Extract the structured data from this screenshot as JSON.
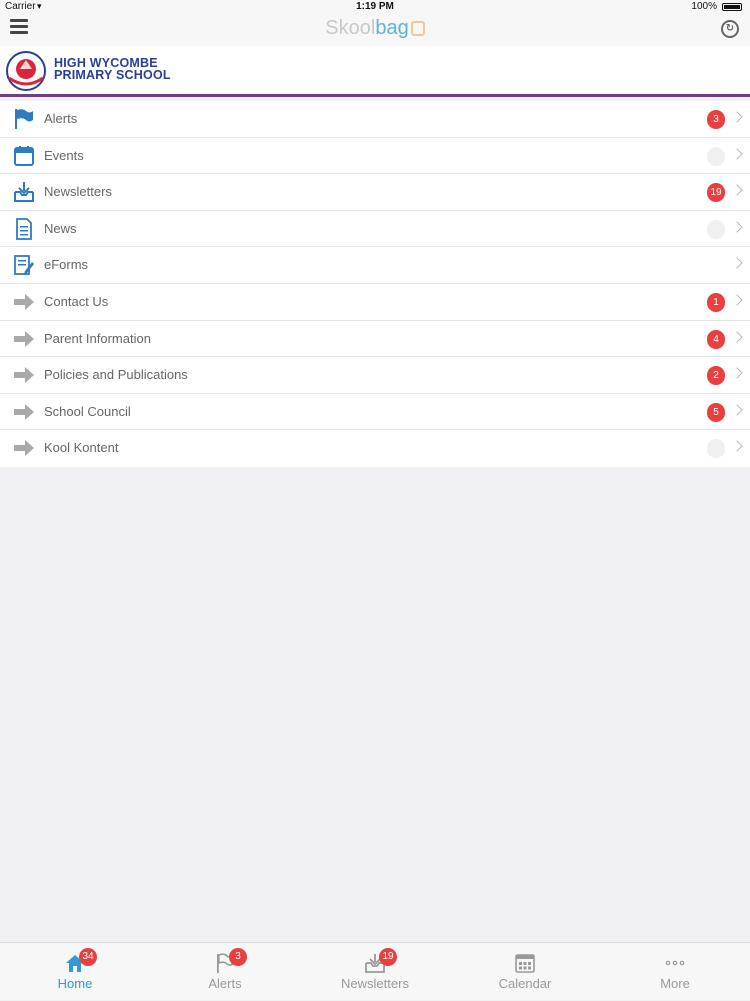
{
  "status_bar": {
    "carrier": "Carrier",
    "time": "1:19 PM",
    "battery": "100%"
  },
  "nav": {
    "brand_light": "Skool",
    "brand_dark": "bag"
  },
  "header": {
    "school_line1": "HIGH WYCOMBE",
    "school_line2": "PRIMARY SCHOOL"
  },
  "menu": [
    {
      "label": "Alerts",
      "icon": "flag-icon",
      "badge": "3"
    },
    {
      "label": "Events",
      "icon": "calendar-icon",
      "badge": ""
    },
    {
      "label": "Newsletters",
      "icon": "inbox-download-icon",
      "badge": "19"
    },
    {
      "label": "News",
      "icon": "document-icon",
      "badge": ""
    },
    {
      "label": "eForms",
      "icon": "form-edit-icon",
      "badge": null
    },
    {
      "label": "Contact Us",
      "icon": "arrow-right-icon",
      "badge": "1"
    },
    {
      "label": "Parent Information",
      "icon": "arrow-right-icon",
      "badge": "4"
    },
    {
      "label": "Policies and Publications",
      "icon": "arrow-right-icon",
      "badge": "2"
    },
    {
      "label": "School Council",
      "icon": "arrow-right-icon",
      "badge": "5"
    },
    {
      "label": "Kool Kontent",
      "icon": "arrow-right-icon",
      "badge": ""
    }
  ],
  "tabs": [
    {
      "label": "Home",
      "icon": "home-icon",
      "badge": "34",
      "active": true
    },
    {
      "label": "Alerts",
      "icon": "flag-icon",
      "badge": "3",
      "active": false
    },
    {
      "label": "Newsletters",
      "icon": "inbox-download-icon",
      "badge": "19",
      "active": false
    },
    {
      "label": "Calendar",
      "icon": "calendar-icon",
      "badge": null,
      "active": false
    },
    {
      "label": "More",
      "icon": "more-dots-icon",
      "badge": null,
      "active": false
    }
  ],
  "colors": {
    "accent": "#2f9ad6",
    "badge": "#e8403f",
    "header_border": "#6b3e85",
    "school_name": "#2a3e9c"
  }
}
